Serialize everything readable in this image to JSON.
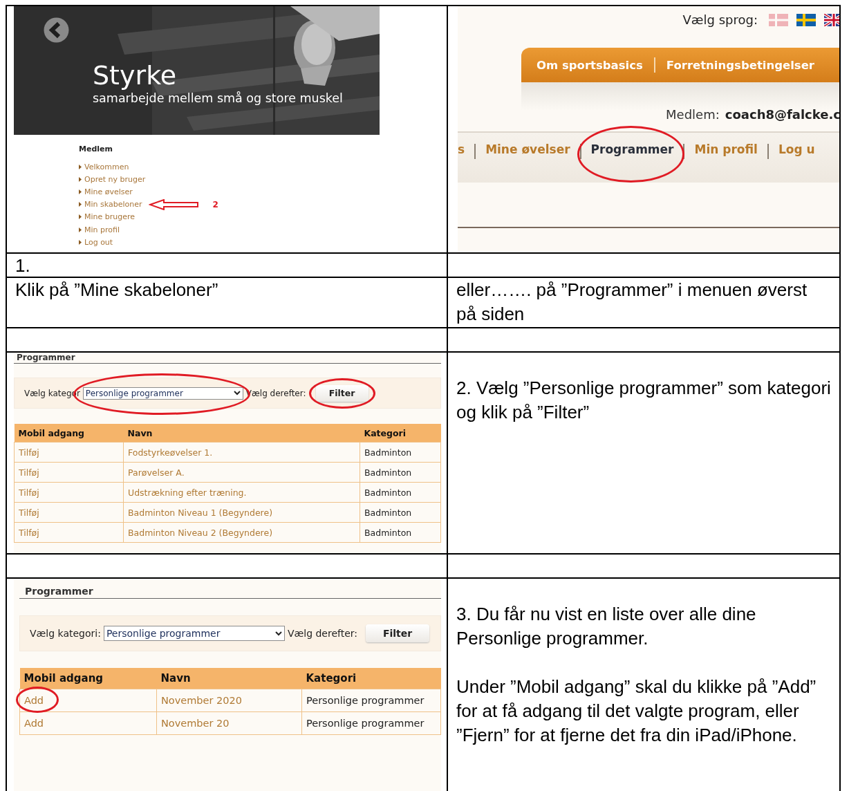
{
  "step1_screens": {
    "member_page": {
      "hero": {
        "kind": "picture",
        "title": "Styrke",
        "subtitle": "samarbejde mellem små og store muskel"
      },
      "menu": {
        "heading": "Medlem",
        "items": [
          {
            "label": "Velkommen"
          },
          {
            "label": "Opret ny bruger"
          },
          {
            "label": "Mine øvelser"
          },
          {
            "label": "Min skabeloner",
            "annotation": "2"
          },
          {
            "label": "Mine brugere"
          },
          {
            "label": "Min profil"
          },
          {
            "label": "Log out"
          }
        ]
      }
    },
    "site_header": {
      "language_label": "Vælg sprog:",
      "flags": [
        {
          "kind": "dk",
          "dimmed": true
        },
        {
          "kind": "se",
          "dimmed": false
        },
        {
          "kind": "gb",
          "dimmed": false
        }
      ],
      "top_nav": [
        "Om sportsbasics",
        "Forretningsbetingelser"
      ],
      "member_label": "Medlem:",
      "member_email": "coach8@falcke.c",
      "main_nav": [
        {
          "label": "s",
          "selected": false,
          "circled": false
        },
        {
          "label": "Mine øvelser",
          "selected": false,
          "circled": false
        },
        {
          "label": "Programmer",
          "selected": true,
          "circled": true
        },
        {
          "label": "Min profil",
          "selected": false,
          "circled": false
        },
        {
          "label": "Log u",
          "selected": false,
          "circled": false
        }
      ]
    }
  },
  "step1_number": "1.",
  "step1_left": "Klik på ”Mine skabeloner”",
  "step1_right": "eller……. på ”Programmer” i menuen øverst på siden",
  "program_screens": [
    {
      "heading": "Programmer",
      "category_label": "Vælg kategor",
      "category_value": "Personlige programmer",
      "category_circled": true,
      "then_label": "Vælg derefter:",
      "filter_button": "Filter",
      "filter_circled": true,
      "columns": [
        "Mobil adgang",
        "Navn",
        "Kategori"
      ],
      "rows": [
        {
          "action": "Tilføj",
          "name": "Fodstyrkeøvelser 1.",
          "category": "Badminton",
          "circled": false
        },
        {
          "action": "Tilføj",
          "name": "Parøvelser A.",
          "category": "Badminton",
          "circled": false
        },
        {
          "action": "Tilføj",
          "name": "Udstrækning efter træning.",
          "category": "Badminton",
          "circled": false
        },
        {
          "action": "Tilføj",
          "name": "Badminton Niveau 1 (Begyndere)",
          "category": "Badminton",
          "circled": false
        },
        {
          "action": "Tilføj",
          "name": "Badminton Niveau 2 (Begyndere)",
          "category": "Badminton",
          "circled": false
        }
      ]
    },
    {
      "heading": "Programmer",
      "category_label": "Vælg kategori:",
      "category_value": "Personlige programmer",
      "category_circled": false,
      "then_label": "Vælg derefter:",
      "filter_button": "Filter",
      "filter_circled": false,
      "columns": [
        "Mobil adgang",
        "Navn",
        "Kategori"
      ],
      "rows": [
        {
          "action": "Add",
          "name": "November 2020",
          "category": "Personlige programmer",
          "circled": true
        },
        {
          "action": "Add",
          "name": "November 20",
          "category": "Personlige programmer",
          "circled": false
        }
      ]
    }
  ],
  "step2_text": "2. Vælg ”Personlige programmer” som kategori og klik på ”Filter”",
  "step3_text": [
    "3. Du får nu vist en liste over alle dine Personlige programmer.",
    "Under ”Mobil adgang” skal du klikke på ”Add” for at få adgang til det valgte program, eller ”Fjern” for at fjerne det fra din iPad/iPhone."
  ]
}
